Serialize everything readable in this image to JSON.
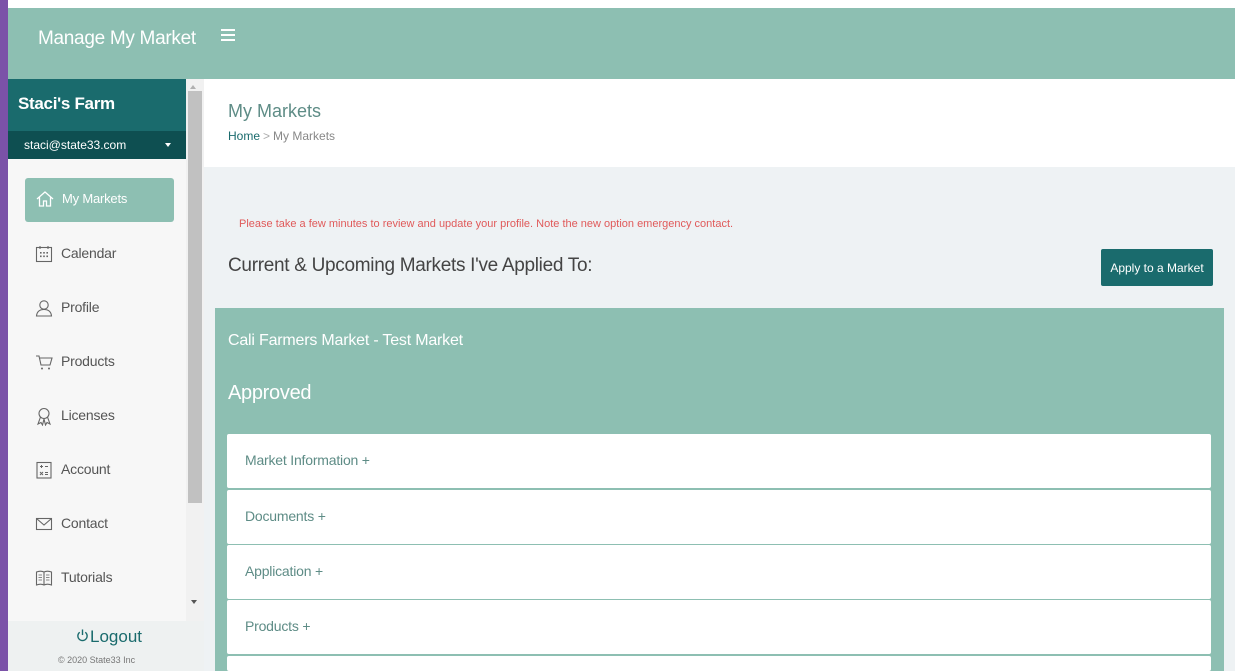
{
  "app": {
    "title": "Manage My Market"
  },
  "sidebar": {
    "farm_name": "Staci's Farm",
    "email": "staci@state33.com",
    "items": [
      {
        "label": "My Markets",
        "icon": "home-icon",
        "active": true
      },
      {
        "label": "Calendar",
        "icon": "calendar-icon"
      },
      {
        "label": "Profile",
        "icon": "user-icon"
      },
      {
        "label": "Products",
        "icon": "cart-icon"
      },
      {
        "label": "Licenses",
        "icon": "award-icon"
      },
      {
        "label": "Account",
        "icon": "calculator-icon"
      },
      {
        "label": "Contact",
        "icon": "envelope-icon"
      },
      {
        "label": "Tutorials",
        "icon": "book-icon"
      }
    ],
    "logout_label": "Logout",
    "copyright": "© 2020 State33 Inc"
  },
  "header": {
    "page_title": "My Markets",
    "breadcrumb": {
      "home": "Home",
      "separator": ">",
      "current": "My Markets"
    }
  },
  "main": {
    "notice": "Please take a few minutes to review and update your profile. Note the new option emergency contact.",
    "section_heading": "Current & Upcoming Markets I've Applied To:",
    "apply_button": "Apply to a Market",
    "market": {
      "name": "Cali Farmers Market - Test Market",
      "status": "Approved",
      "sections": [
        "Market Information +",
        "Documents +",
        "Application +",
        "Products +"
      ]
    }
  },
  "colors": {
    "topbar": "#8dbfb2",
    "sidebar_header": "#1a6b6d",
    "email_bar": "#0e4f51",
    "active_nav": "#8dbfb2",
    "notice_text": "#e05a5a",
    "button": "#1a6b6d"
  }
}
